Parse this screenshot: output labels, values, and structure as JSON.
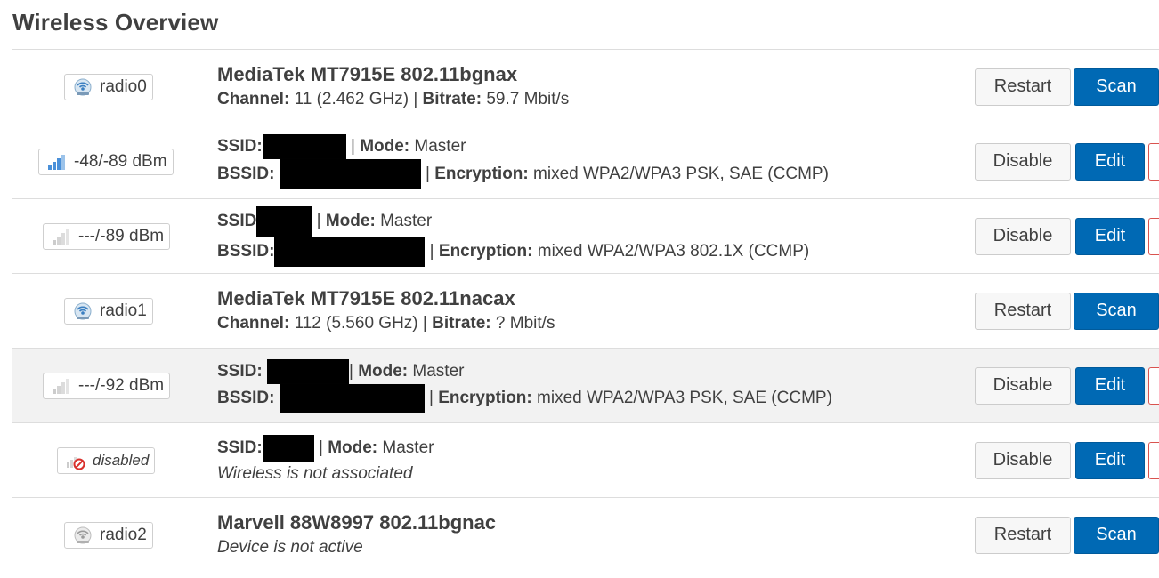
{
  "page": {
    "title": "Wireless Overview"
  },
  "buttons": {
    "restart": "Restart",
    "scan": "Scan",
    "disable": "Disable",
    "edit": "Edit"
  },
  "labels": {
    "channel": "Channel:",
    "bitrate": "Bitrate:",
    "ssid": "SSID:",
    "ssid_nocolon": "SSID",
    "bssid": "BSSID:",
    "mode": "Mode:",
    "encryption": "Encryption:"
  },
  "rows": [
    {
      "type": "radio",
      "badge": "radio0",
      "icon": "wifi-radio-icon",
      "name": "MediaTek MT7915E 802.11bgnax",
      "channel": "11 (2.462 GHz)",
      "bitrate": "59.7 Mbit/s"
    },
    {
      "type": "iface",
      "badge": "-48/-89 dBm",
      "icon": "signal-strength-icon",
      "mode": "Master",
      "encryption": "mixed WPA2/WPA3 PSK, SAE (CCMP)"
    },
    {
      "type": "iface",
      "badge": "---/-89 dBm",
      "icon": "signal-none-icon",
      "mode": "Master",
      "encryption": "mixed WPA2/WPA3 802.1X (CCMP)"
    },
    {
      "type": "radio",
      "badge": "radio1",
      "icon": "wifi-radio-icon",
      "name": "MediaTek MT7915E 802.11nacax",
      "channel": "112 (5.560 GHz)",
      "bitrate": "? Mbit/s"
    },
    {
      "type": "iface",
      "badge": "---/-92 dBm",
      "icon": "signal-none-icon",
      "mode": "Master",
      "encryption": "mixed WPA2/WPA3 PSK, SAE (CCMP)"
    },
    {
      "type": "iface",
      "badge": "disabled",
      "icon": "signal-disabled-icon",
      "mode": "Master",
      "status": "Wireless is not associated"
    },
    {
      "type": "radio",
      "badge": "radio2",
      "icon": "wifi-radio-inactive-icon",
      "name": "Marvell 88W8997 802.11bgnac",
      "status": "Device is not active"
    }
  ],
  "colors": {
    "primary": "#0069b4",
    "text": "#404040",
    "border": "#dddddd",
    "highlight_row": "#f2f2f2",
    "danger": "#d9534f"
  }
}
